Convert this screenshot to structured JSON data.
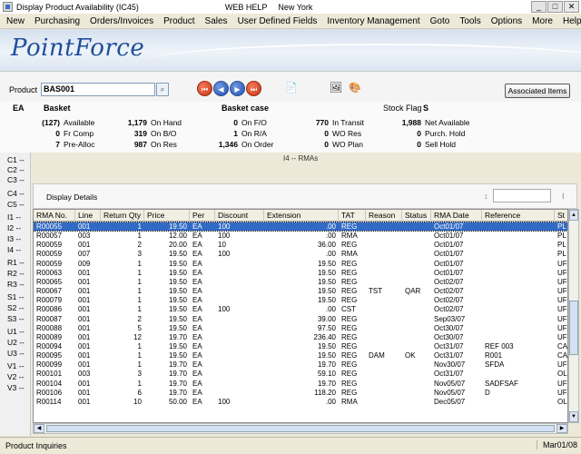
{
  "window": {
    "title": "Display Product Availability (IC45)",
    "help": "WEB HELP",
    "location": "New York",
    "btn_min": "_",
    "btn_max": "□",
    "btn_close": "✕"
  },
  "menu": [
    "New",
    "Purchasing",
    "Orders/Invoices",
    "Product",
    "Sales",
    "User Defined Fields",
    "Inventory Management",
    "Goto",
    "Tools",
    "Options",
    "More",
    "Help"
  ],
  "banner": {
    "logo": "PointForce"
  },
  "product": {
    "label": "Product",
    "value": "BAS001",
    "associated_items": "Associated Items"
  },
  "header": {
    "unit": "EA",
    "basket_label": "Basket",
    "description": "Basket case",
    "stock_flag_label": "Stock Flag",
    "stock_flag": "S"
  },
  "stats": [
    {
      "v": "(127)",
      "k": "Available"
    },
    {
      "v": "0",
      "k": "Fr Comp"
    },
    {
      "v": "7",
      "k": "Pre-Alloc"
    },
    {
      "v": "1,179",
      "k": "On Hand"
    },
    {
      "v": "319",
      "k": "On B/O"
    },
    {
      "v": "987",
      "k": "On Res"
    },
    {
      "v": "0",
      "k": "On F/O"
    },
    {
      "v": "1",
      "k": "On R/A"
    },
    {
      "v": "1,346",
      "k": "On Order"
    },
    {
      "v": "770",
      "k": "In Transit"
    },
    {
      "v": "0",
      "k": "WO Res"
    },
    {
      "v": "0",
      "k": "WO Plan"
    },
    {
      "v": "1,988",
      "k": "Net Available"
    },
    {
      "v": "0",
      "k": "Purch. Hold"
    },
    {
      "v": "0",
      "k": "Sell Hold"
    }
  ],
  "sidebar": [
    "C1 --",
    "C2 --",
    "C3 --",
    "C4 --",
    "C5 --",
    "I1 --",
    "I2 --",
    "I3 --",
    "I4 --",
    "R1 --",
    "R2 --",
    "R3 --",
    "S1 --",
    "S2 --",
    "S3 --",
    "U1 --",
    "U2 --",
    "U3 --",
    "V1 --",
    "V2 --",
    "V3 --"
  ],
  "tab_title": "I4  --  RMAs",
  "details": {
    "label": "Display Details",
    "up_symbol": "↕",
    "down_symbol": "I"
  },
  "columns": [
    "RMA No.",
    "Line",
    "Return Qty",
    "Price",
    "Per",
    "Discount",
    "Extension",
    "TAT",
    "Reason",
    "Status",
    "RMA Date",
    "Reference",
    "St"
  ],
  "rows": [
    [
      "R00055",
      "001",
      "1",
      "19.50",
      "EA",
      "100",
      ".00",
      "REG",
      "",
      "",
      "Oct01/07",
      "",
      "PL"
    ],
    [
      "R00057",
      "003",
      "1",
      "12.00",
      "EA",
      "100",
      ".00",
      "RMA",
      "",
      "",
      "Oct01/07",
      "",
      "PL"
    ],
    [
      "R00059",
      "001",
      "2",
      "20.00",
      "EA",
      "10",
      "36.00",
      "REG",
      "",
      "",
      "Oct01/07",
      "",
      "PL"
    ],
    [
      "R00059",
      "007",
      "3",
      "19.50",
      "EA",
      "100",
      ".00",
      "RMA",
      "",
      "",
      "Oct01/07",
      "",
      "PL"
    ],
    [
      "R00059",
      "009",
      "1",
      "19.50",
      "EA",
      "",
      "19.50",
      "REG",
      "",
      "",
      "Oct01/07",
      "",
      "UF"
    ],
    [
      "R00063",
      "001",
      "1",
      "19.50",
      "EA",
      "",
      "19.50",
      "REG",
      "",
      "",
      "Oct01/07",
      "",
      "UF"
    ],
    [
      "R00065",
      "001",
      "1",
      "19.50",
      "EA",
      "",
      "19.50",
      "REG",
      "",
      "",
      "Oct02/07",
      "",
      "UF"
    ],
    [
      "R00067",
      "001",
      "1",
      "19.50",
      "EA",
      "",
      "19.50",
      "REG",
      "TST",
      "QAR",
      "Oct02/07",
      "",
      "UF"
    ],
    [
      "R00079",
      "001",
      "1",
      "19.50",
      "EA",
      "",
      "19.50",
      "REG",
      "",
      "",
      "Oct02/07",
      "",
      "UF"
    ],
    [
      "R00086",
      "001",
      "1",
      "19.50",
      "EA",
      "100",
      ".00",
      "CST",
      "",
      "",
      "Oct02/07",
      "",
      "UF"
    ],
    [
      "R00087",
      "001",
      "2",
      "19.50",
      "EA",
      "",
      "39.00",
      "REG",
      "",
      "",
      "Sep03/07",
      "",
      "UF"
    ],
    [
      "R00088",
      "001",
      "5",
      "19.50",
      "EA",
      "",
      "97.50",
      "REG",
      "",
      "",
      "Oct30/07",
      "",
      "UF"
    ],
    [
      "R00089",
      "001",
      "12",
      "19.70",
      "EA",
      "",
      "236.40",
      "REG",
      "",
      "",
      "Oct30/07",
      "",
      "UF"
    ],
    [
      "R00094",
      "001",
      "1",
      "19.50",
      "EA",
      "",
      "19.50",
      "REG",
      "",
      "",
      "Oct31/07",
      "REF 003",
      "CA"
    ],
    [
      "R00095",
      "001",
      "1",
      "19.50",
      "EA",
      "",
      "19.50",
      "REG",
      "DAM",
      "OK",
      "Oct31/07",
      "R001",
      "CA"
    ],
    [
      "R00099",
      "001",
      "1",
      "19.70",
      "EA",
      "",
      "19.70",
      "REG",
      "",
      "",
      "Nov30/07",
      "SFDA",
      "UF"
    ],
    [
      "R00101",
      "003",
      "3",
      "19.70",
      "EA",
      "",
      "59.10",
      "REG",
      "",
      "",
      "Oct31/07",
      "",
      "OL"
    ],
    [
      "R00104",
      "001",
      "1",
      "19.70",
      "EA",
      "",
      "19.70",
      "REG",
      "",
      "",
      "Nov05/07",
      "SADFSAF",
      "UF"
    ],
    [
      "R00106",
      "001",
      "6",
      "19.70",
      "EA",
      "",
      "118.20",
      "REG",
      "",
      "",
      "Nov05/07",
      "D",
      "UF"
    ],
    [
      "R00114",
      "001",
      "10",
      "50.00",
      "EA",
      "100",
      ".00",
      "RMA",
      "",
      "",
      "Dec05/07",
      "",
      "OL"
    ]
  ],
  "status": {
    "left": "Product Inquiries",
    "right": "Mar01/08"
  },
  "colors": {
    "selection": "#316ac5",
    "logo": "#1f4f9c"
  }
}
